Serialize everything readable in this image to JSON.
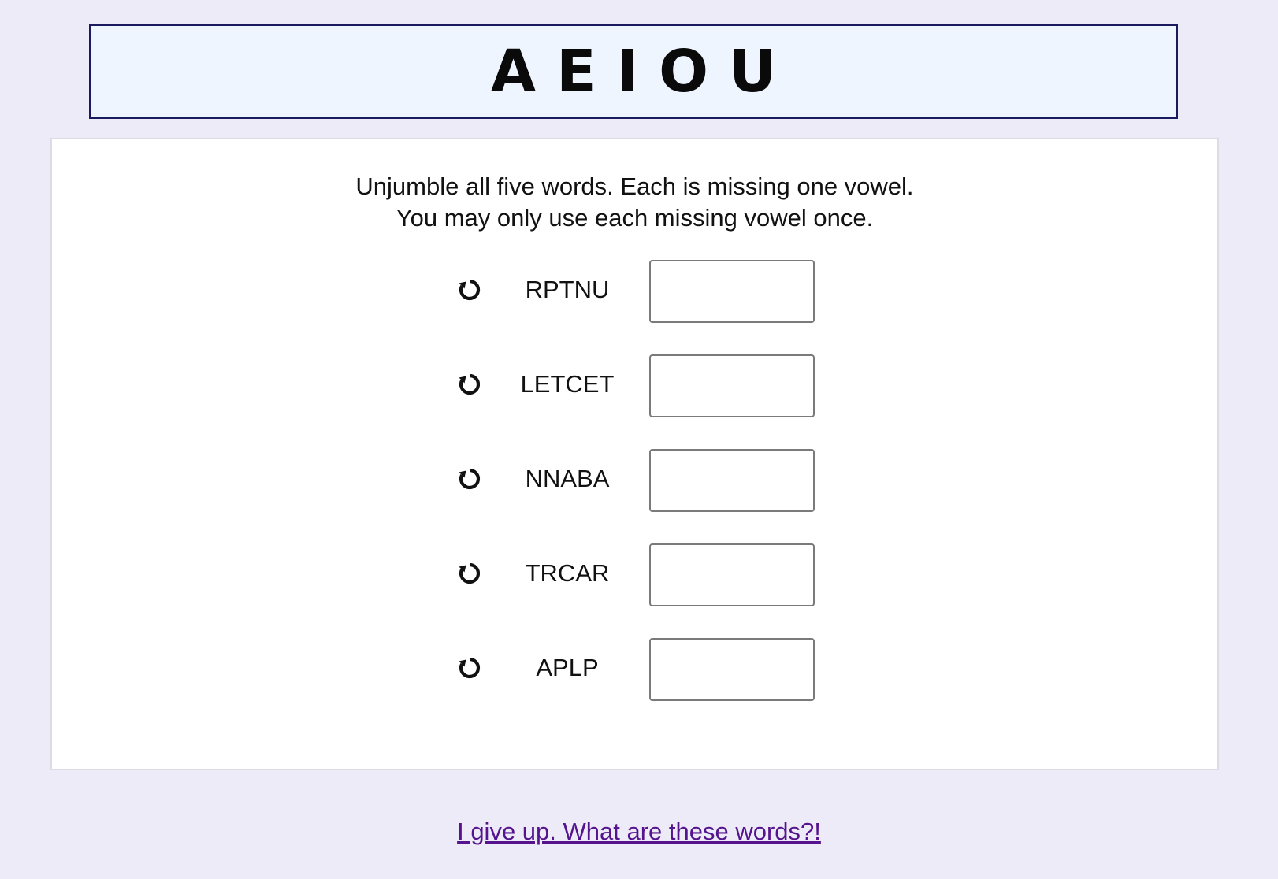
{
  "header": {
    "title": "AEIOU"
  },
  "instructions": {
    "line1": "Unjumble all five words. Each is missing one vowel.",
    "line2": "You may only use each missing vowel once."
  },
  "puzzle": {
    "rows": [
      {
        "jumble": "RPTNU",
        "answer_value": "",
        "answer_placeholder": "",
        "icon": "reload-icon"
      },
      {
        "jumble": "LETCET",
        "answer_value": "",
        "answer_placeholder": "",
        "icon": "reload-icon"
      },
      {
        "jumble": "NNABA",
        "answer_value": "",
        "answer_placeholder": "",
        "icon": "reload-icon"
      },
      {
        "jumble": "TRCAR",
        "answer_value": "",
        "answer_placeholder": "",
        "icon": "reload-icon"
      },
      {
        "jumble": "APLP",
        "answer_value": "",
        "answer_placeholder": "",
        "icon": "reload-icon"
      }
    ]
  },
  "footer": {
    "give_up_link": "I give up. What are these words?!"
  },
  "colors": {
    "page_background": "#ecebf7",
    "title_background": "#eef5ff",
    "title_border": "#1a1a5e",
    "panel_background": "#ffffff",
    "link": "#55148e"
  }
}
